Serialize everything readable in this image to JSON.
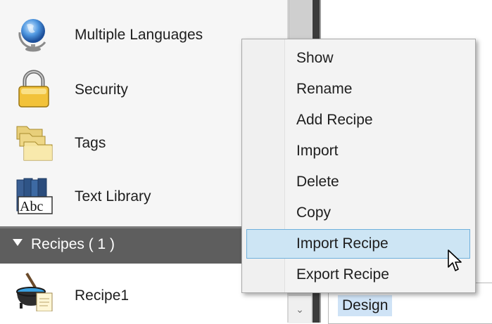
{
  "left_panel": {
    "items": [
      {
        "label": "Multiple Languages",
        "icon": "globe-icon"
      },
      {
        "label": "Security",
        "icon": "padlock-icon"
      },
      {
        "label": "Tags",
        "icon": "folders-icon"
      },
      {
        "label": "Text Library",
        "icon": "text-library-icon"
      }
    ],
    "section": {
      "title": "Recipes ( 1 )",
      "icon": "expand-arrow-icon"
    },
    "recipes": [
      {
        "label": "Recipe1",
        "icon": "cauldron-icon"
      }
    ]
  },
  "context_menu": {
    "items": [
      {
        "label": "Show"
      },
      {
        "label": "Rename"
      },
      {
        "label": "Add Recipe"
      },
      {
        "label": "Import"
      },
      {
        "label": "Delete"
      },
      {
        "label": "Copy"
      },
      {
        "label": "Import Recipe"
      },
      {
        "label": "Export Recipe"
      }
    ],
    "highlighted_item": "Import Recipe"
  },
  "right_pane": {
    "tab_label": "Design"
  },
  "scrollbar": {
    "down_arrow": "⌄"
  },
  "colors": {
    "section_header": "#5e5e5e",
    "menu_highlight": "#cde5f4",
    "menu_highlight_border": "#6fb0dc",
    "design_tab": "#cfe3f6"
  }
}
